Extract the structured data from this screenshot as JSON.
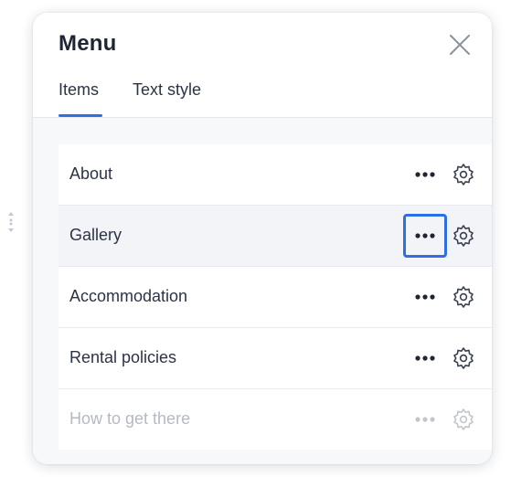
{
  "panel": {
    "title": "Menu",
    "tabs": [
      {
        "label": "Items",
        "active": true
      },
      {
        "label": "Text style",
        "active": false
      }
    ],
    "accent_color": "#2f6fe4"
  },
  "menu_items": [
    {
      "label": "About",
      "state": "normal"
    },
    {
      "label": "Gallery",
      "state": "hover"
    },
    {
      "label": "Accommodation",
      "state": "normal"
    },
    {
      "label": "Rental policies",
      "state": "normal"
    },
    {
      "label": "How to get there",
      "state": "disabled"
    }
  ],
  "icons": {
    "close": "close-icon",
    "more": "more-dots-icon",
    "settings": "gear-icon",
    "drag": "drag-handle-icon"
  }
}
